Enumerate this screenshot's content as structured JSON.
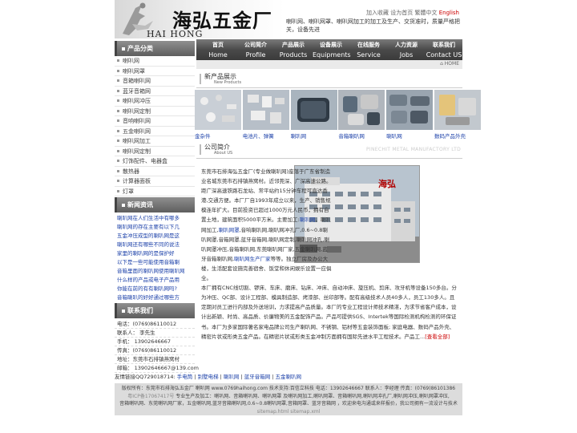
{
  "header": {
    "logo_cn": "海弘五金厂",
    "logo_en": "HAI HONG",
    "toplinks": [
      "加入收藏",
      "设为首页",
      "繁體中文"
    ],
    "toplink_en": "English",
    "tagline": "喇叭网、喇叭网罩、喇叭网加工的加工及生产、交货准时，质量严格把关，设备先进"
  },
  "nav": [
    {
      "cn": "首页",
      "en": "Home"
    },
    {
      "cn": "公司简介",
      "en": "Profile"
    },
    {
      "cn": "产品展示",
      "en": "Products"
    },
    {
      "cn": "设备展示",
      "en": "Equipments"
    },
    {
      "cn": "在线服务",
      "en": "Service"
    },
    {
      "cn": "人力资源",
      "en": "Jobs"
    },
    {
      "cn": "联系我们",
      "en": "Contact US"
    }
  ],
  "sidebar": {
    "categories_title": "产品分类",
    "categories": [
      "喇叭网",
      "喇叭网罩",
      "音箱喇叭网",
      "蓝牙音箱网",
      "喇叭网冲压",
      "喇叭网定制",
      "音响喇叭网",
      "五金喇叭网",
      "喇叭网加工",
      "喇叭网定制",
      "灯饰配件、电器盒",
      "散热器",
      "计算器面板",
      "灯罩"
    ],
    "news_title": "新闻资讯",
    "news": [
      "喇叭网在人们生活中有哪多",
      "喇叭网的存在主要有以下几",
      "五金冲压成型的喇叭网是这",
      "喇叭网还有哪些不同的说法",
      "家里的喇叭网的是保护好",
      "以下是一些可能使用音箱喇",
      "音箱里面的喇叭网使用喇叭网",
      "什么样的产品或电子产品用",
      "你能在前的有有喇叭网吗?",
      "音箱喇叭的好好通过哪些方"
    ],
    "contact_title": "联系我们",
    "contact": [
      "电话：(0769)86110012",
      "联系人：  李先生",
      "手机：  13902646667",
      "传真：(0769)86110012",
      "地址：东莞市石排镇燕窝村",
      "邮箱：  13902646667@139.com"
    ]
  },
  "home_link": "HOME",
  "products_section": {
    "cn": "新产品展示",
    "en": "New Products"
  },
  "products": [
    {
      "label": "金杂件"
    },
    {
      "label": "电池片、弹簧"
    },
    {
      "label": "喇叭网"
    },
    {
      "label": "音箱喇叭网"
    },
    {
      "label": "喇叭网"
    },
    {
      "label": "数码产品外壳"
    }
  ],
  "about_section": {
    "cn": "公司简介",
    "en": "About US",
    "watermark": "PINECHIT METAL MANUFACTORY LTD"
  },
  "about": {
    "image_sign": "海弘",
    "p1": "东莞市石排海弘五金厂(专业做喇叭网)座落于广东省制造业名城东莞市石排镇燕窝村。近邻莞深、广深高速公路。距广深高速铁路石龙站、常平站约15分钟车程可直达香港,交通方便。本厂厂自1993年成立以来，生产、销售规模连年扩大。目前投资已超过1000万元人民币，拥有自置土地，建筑面积5000平方米。主要加工:",
    "p1_link1": "喇叭网",
    "p1_mid": "，喇叭网加工,",
    "p1_link2": "喇叭网罩",
    "p1_rest": ",音响喇叭网,喇叭网冲孔厂,0.6~0.8喇叭网罩,音箱网罩,蓝牙音箱网,喇叭网定制,喇叭网冲孔,喇叭网罩冲压,音箱喇叭网,东莞喇叭网厂家,五金喇叭网,蓝牙音箱喇叭网,",
    "p1_link3": "喇叭网生产厂家",
    "p1_tail": "等等。独立厂房及办公大楼，生活配套设施完善宿舍、饭堂和休闲娱乐设置一应俱全。",
    "p2": "本厂拥有CNC线切割、锣床、车床、磨床、钻床、冲床、自动冲床、旋压机、剪床、攻牙机等设备150多台。分为冲压、QC部、设计工程部、模具制造部、烤漆部、丝印部等。配有高级技术人员40多人，员工130多人。且定期对员工进行内部及外送培训，力求提高产品质量。本厂的专业工程设计师技术精湛，为求节省客户成本，设计出新颖、时尚、高品质、价廉物美的五金配饰产品。产品可提供SGS、Intertek等国际检测机构检测的环保证书。本厂为多家国际著名家电品牌公司生产喇叭网、不锈钢、铝材等五金装饰面板; 家庭电器、数码产品外壳、精密片状或形类五金产品。在精密片状或形类五金冲制方面拥有国际先进水平工程技术。产品工...",
    "more": "[查看全部]"
  },
  "friend_links": {
    "label": "友情链接QQ729018714:",
    "links": [
      "手电筒",
      "别墅电梯",
      "喇叭网",
      "蓝牙音箱网",
      "五金喇叭网"
    ]
  },
  "footer": {
    "line1": "版权所有：东莞市石排海弘五金厂 喇叭网 www.0769haihong.com 技术支持:百信立科技 电话：13902646667 联系人：李经理 传真：(0769)86101386",
    "line2_icp": "粤ICP备17067417号",
    "line2": "专业生产及加工：喇叭网、音箱喇叭网、喇叭网罩 及喇叭网加工,喇叭网罩、音箱喇叭网,喇叭网冲孔厂,喇叭网冲压,喇叭网罩冲压,",
    "line3": "音箱喇叭网、东莞喇叭网厂家，五金喇叭网,蓝牙音箱喇叭网,0.6~0.8喇叭网罩,音箱网罩、蓝牙音箱网 ，欢迎来电沟通或来样报价，我公司拥有一流设计与技术",
    "line4": "sitemap.html  sitemap.xml"
  }
}
